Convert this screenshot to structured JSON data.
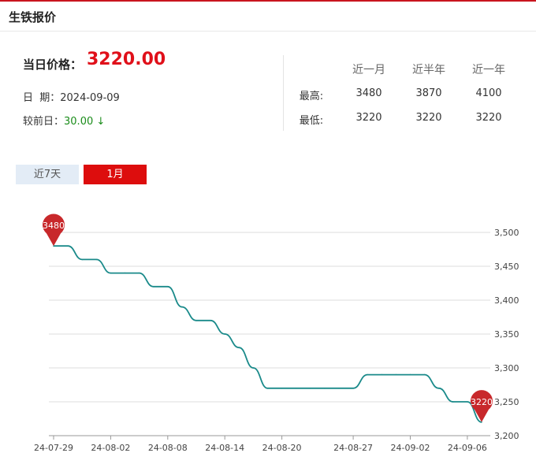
{
  "header": {
    "title": "生铁报价"
  },
  "price": {
    "label": "当日价格：",
    "value": "3220.00"
  },
  "date": {
    "label": "日  期：",
    "value": "2024-09-09"
  },
  "change": {
    "label": "较前日：",
    "value": "30.00 ↓"
  },
  "stats": {
    "columns": [
      "近一月",
      "近半年",
      "近一年"
    ],
    "rows": [
      {
        "label": "最高:",
        "values": [
          "3480",
          "3870",
          "4100"
        ]
      },
      {
        "label": "最低:",
        "values": [
          "3220",
          "3220",
          "3220"
        ]
      }
    ]
  },
  "tabs": [
    {
      "label": "近7天",
      "active": false
    },
    {
      "label": "1月",
      "active": true
    }
  ],
  "colors": {
    "line": "#1a8a8a",
    "accent": "#e0101a",
    "marker": "#c8282b"
  },
  "chart_data": {
    "type": "line",
    "title": "",
    "xlabel": "",
    "ylabel": "",
    "ylim": [
      3200,
      3500
    ],
    "yticks": [
      "3,500",
      "3,450",
      "3,400",
      "3,350",
      "3,300",
      "3,250",
      "3,200"
    ],
    "xticks": [
      "24-07-29",
      "24-08-02",
      "24-08-08",
      "24-08-14",
      "24-08-20",
      "24-08-27",
      "24-09-02",
      "24-09-06"
    ],
    "grid": true,
    "x": [
      "24-07-29",
      "24-07-30",
      "24-07-31",
      "24-08-01",
      "24-08-02",
      "24-08-05",
      "24-08-06",
      "24-08-07",
      "24-08-08",
      "24-08-09",
      "24-08-12",
      "24-08-13",
      "24-08-14",
      "24-08-15",
      "24-08-16",
      "24-08-19",
      "24-08-20",
      "24-08-21",
      "24-08-22",
      "24-08-23",
      "24-08-26",
      "24-08-27",
      "24-08-28",
      "24-08-29",
      "24-08-30",
      "24-09-02",
      "24-09-03",
      "24-09-04",
      "24-09-05",
      "24-09-06",
      "24-09-09"
    ],
    "series": [
      {
        "values": [
          3480,
          3480,
          3460,
          3460,
          3440,
          3440,
          3440,
          3420,
          3420,
          3390,
          3370,
          3370,
          3350,
          3330,
          3300,
          3270,
          3270,
          3270,
          3270,
          3270,
          3270,
          3270,
          3290,
          3290,
          3290,
          3290,
          3290,
          3270,
          3250,
          3250,
          3220
        ]
      }
    ],
    "markers": [
      {
        "label": "3480",
        "index": 0
      },
      {
        "label": "3220",
        "index": 30
      }
    ]
  }
}
